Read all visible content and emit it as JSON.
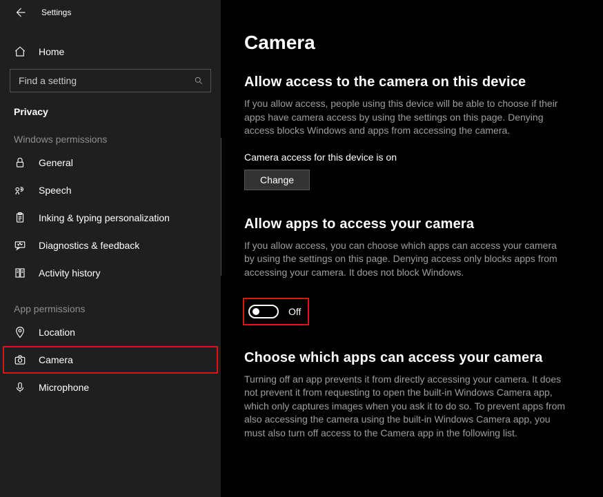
{
  "app_title": "Settings",
  "home_label": "Home",
  "search_placeholder": "Find a setting",
  "sidebar_section": "Privacy",
  "groups": {
    "windows_permissions": "Windows permissions",
    "app_permissions": "App permissions"
  },
  "sidebar": {
    "win_items": [
      {
        "label": "General"
      },
      {
        "label": "Speech"
      },
      {
        "label": "Inking & typing personalization"
      },
      {
        "label": "Diagnostics & feedback"
      },
      {
        "label": "Activity history"
      }
    ],
    "app_items": [
      {
        "label": "Location"
      },
      {
        "label": "Camera"
      },
      {
        "label": "Microphone"
      }
    ]
  },
  "page": {
    "title": "Camera",
    "s1_title": "Allow access to the camera on this device",
    "s1_desc": "If you allow access, people using this device will be able to choose if their apps have camera access by using the settings on this page. Denying access blocks Windows and apps from accessing the camera.",
    "s1_status": "Camera access for this device is on",
    "change_btn": "Change",
    "s2_title": "Allow apps to access your camera",
    "s2_desc": "If you allow access, you can choose which apps can access your camera by using the settings on this page. Denying access only blocks apps from accessing your camera. It does not block Windows.",
    "toggle_state": "Off",
    "s3_title": "Choose which apps can access your camera",
    "s3_desc": "Turning off an app prevents it from directly accessing your camera. It does not prevent it from requesting to open the built-in Windows Camera app, which only captures images when you ask it to do so. To prevent apps from also accessing the camera using the built-in Windows Camera app, you must also turn off access to the Camera app in the following list."
  },
  "colors": {
    "highlight": "#e11414"
  }
}
